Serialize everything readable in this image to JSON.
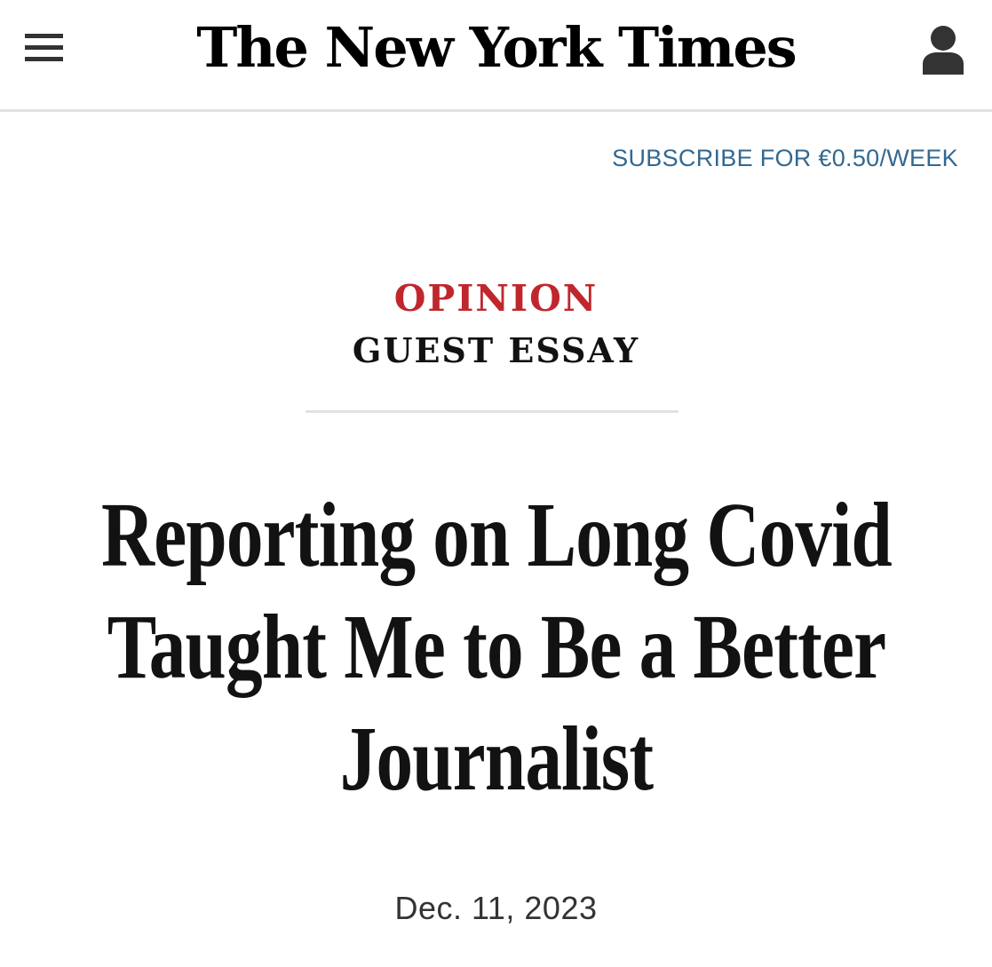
{
  "masthead": {
    "menu_icon": "hamburger-menu-icon",
    "logo_text": "The New York Times",
    "account_icon": "user-account-icon"
  },
  "subscribe": {
    "label": "SUBSCRIBE FOR €0.50/WEEK"
  },
  "article": {
    "section": "OPINION",
    "subsection": "GUEST ESSAY",
    "headline": "Reporting on Long Covid Taught Me to Be a Better Journalist",
    "date": "Dec. 11, 2023"
  },
  "colors": {
    "section_red": "#c0272d",
    "link_blue": "#326891",
    "text": "#121212",
    "divider": "#e2e2e2"
  }
}
